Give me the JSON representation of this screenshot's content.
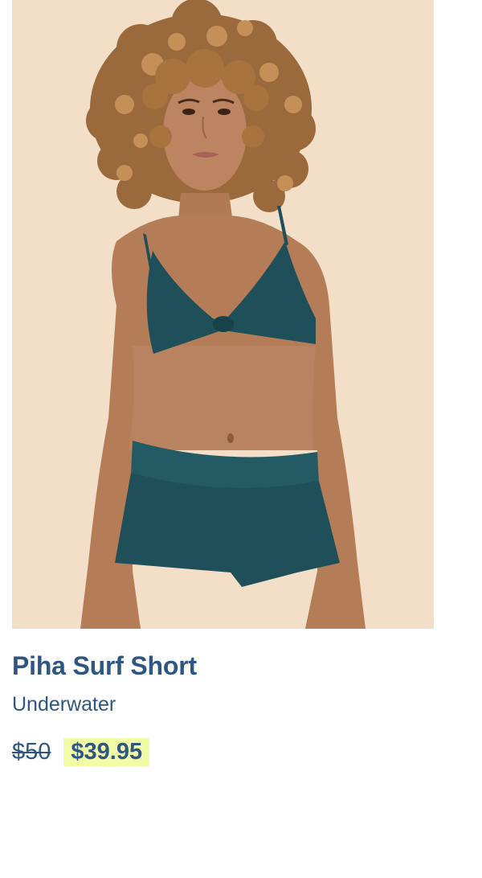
{
  "product": {
    "title": "Piha Surf Short",
    "color_name": "Underwater",
    "price_original": "$50",
    "price_sale": "$39.95",
    "image_alt": "Model wearing teal bikini top and Piha Surf Short"
  },
  "colors": {
    "title": "#2f5585",
    "sale_highlight": "#f2fca6",
    "image_background": "#f3dfc8",
    "garment": "#1f4f58"
  }
}
